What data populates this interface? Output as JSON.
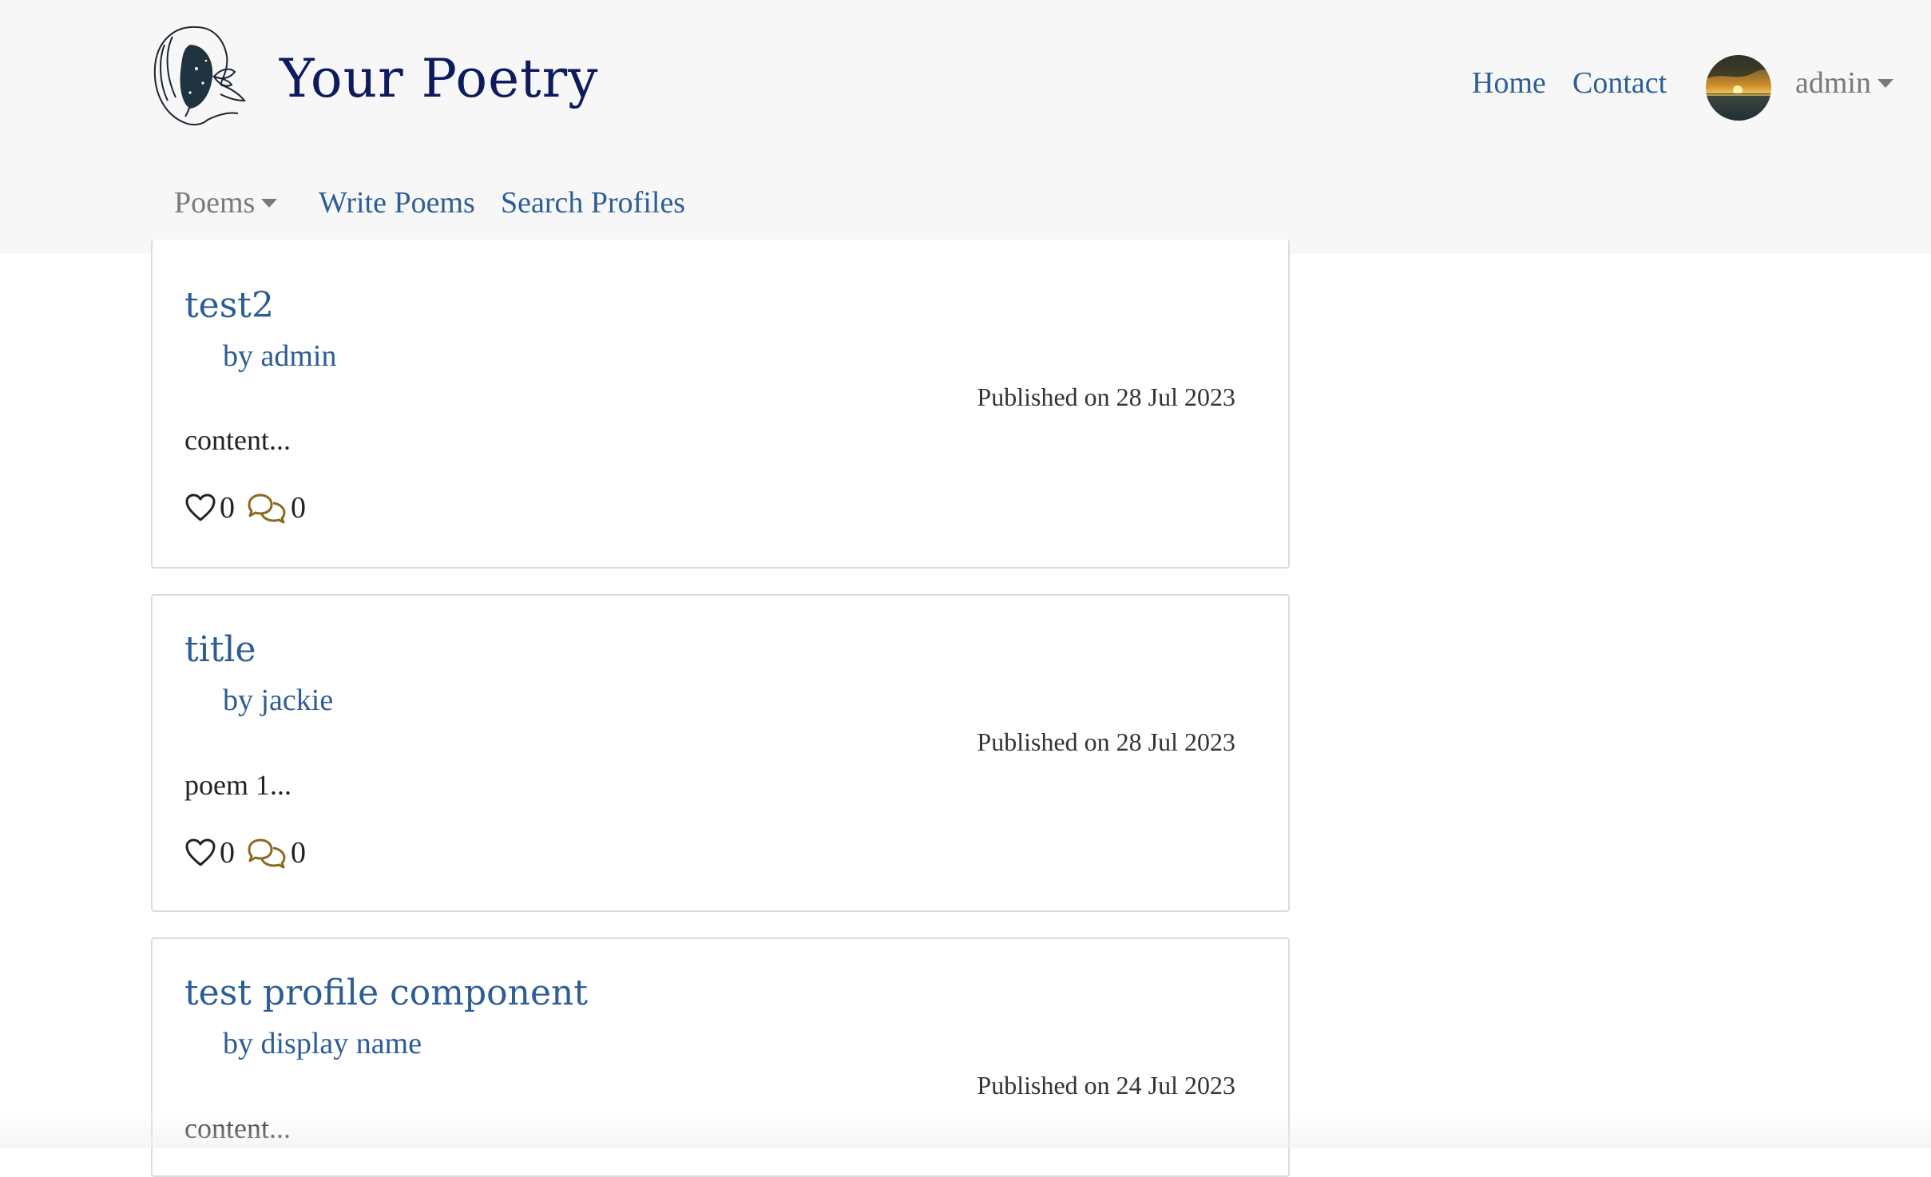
{
  "header": {
    "brand_title": "Your Poetry",
    "logo_icon": "woman-face-butterfly-logo",
    "nav": {
      "home": "Home",
      "contact": "Contact"
    },
    "user": {
      "name": "admin",
      "avatar": "sunset-avatar"
    },
    "sub_nav": {
      "poems": "Poems",
      "write": "Write Poems",
      "search": "Search Profiles"
    }
  },
  "poems": [
    {
      "title": "test2",
      "author": "by admin",
      "published": "Published on 28 Jul 2023",
      "excerpt": "content...",
      "likes": "0",
      "comments": "0"
    },
    {
      "title": "title",
      "author": "by jackie",
      "published": "Published on 28 Jul 2023",
      "excerpt": "poem 1...",
      "likes": "0",
      "comments": "0"
    },
    {
      "title": "test profile component",
      "author": "by display name",
      "published": "Published on 24 Jul 2023",
      "excerpt": "content..."
    }
  ],
  "colors": {
    "link": "#2d5d96",
    "brand": "#0d1a5e",
    "comment_icon": "#8a6a1f",
    "header_bg": "#f7f7f7"
  }
}
